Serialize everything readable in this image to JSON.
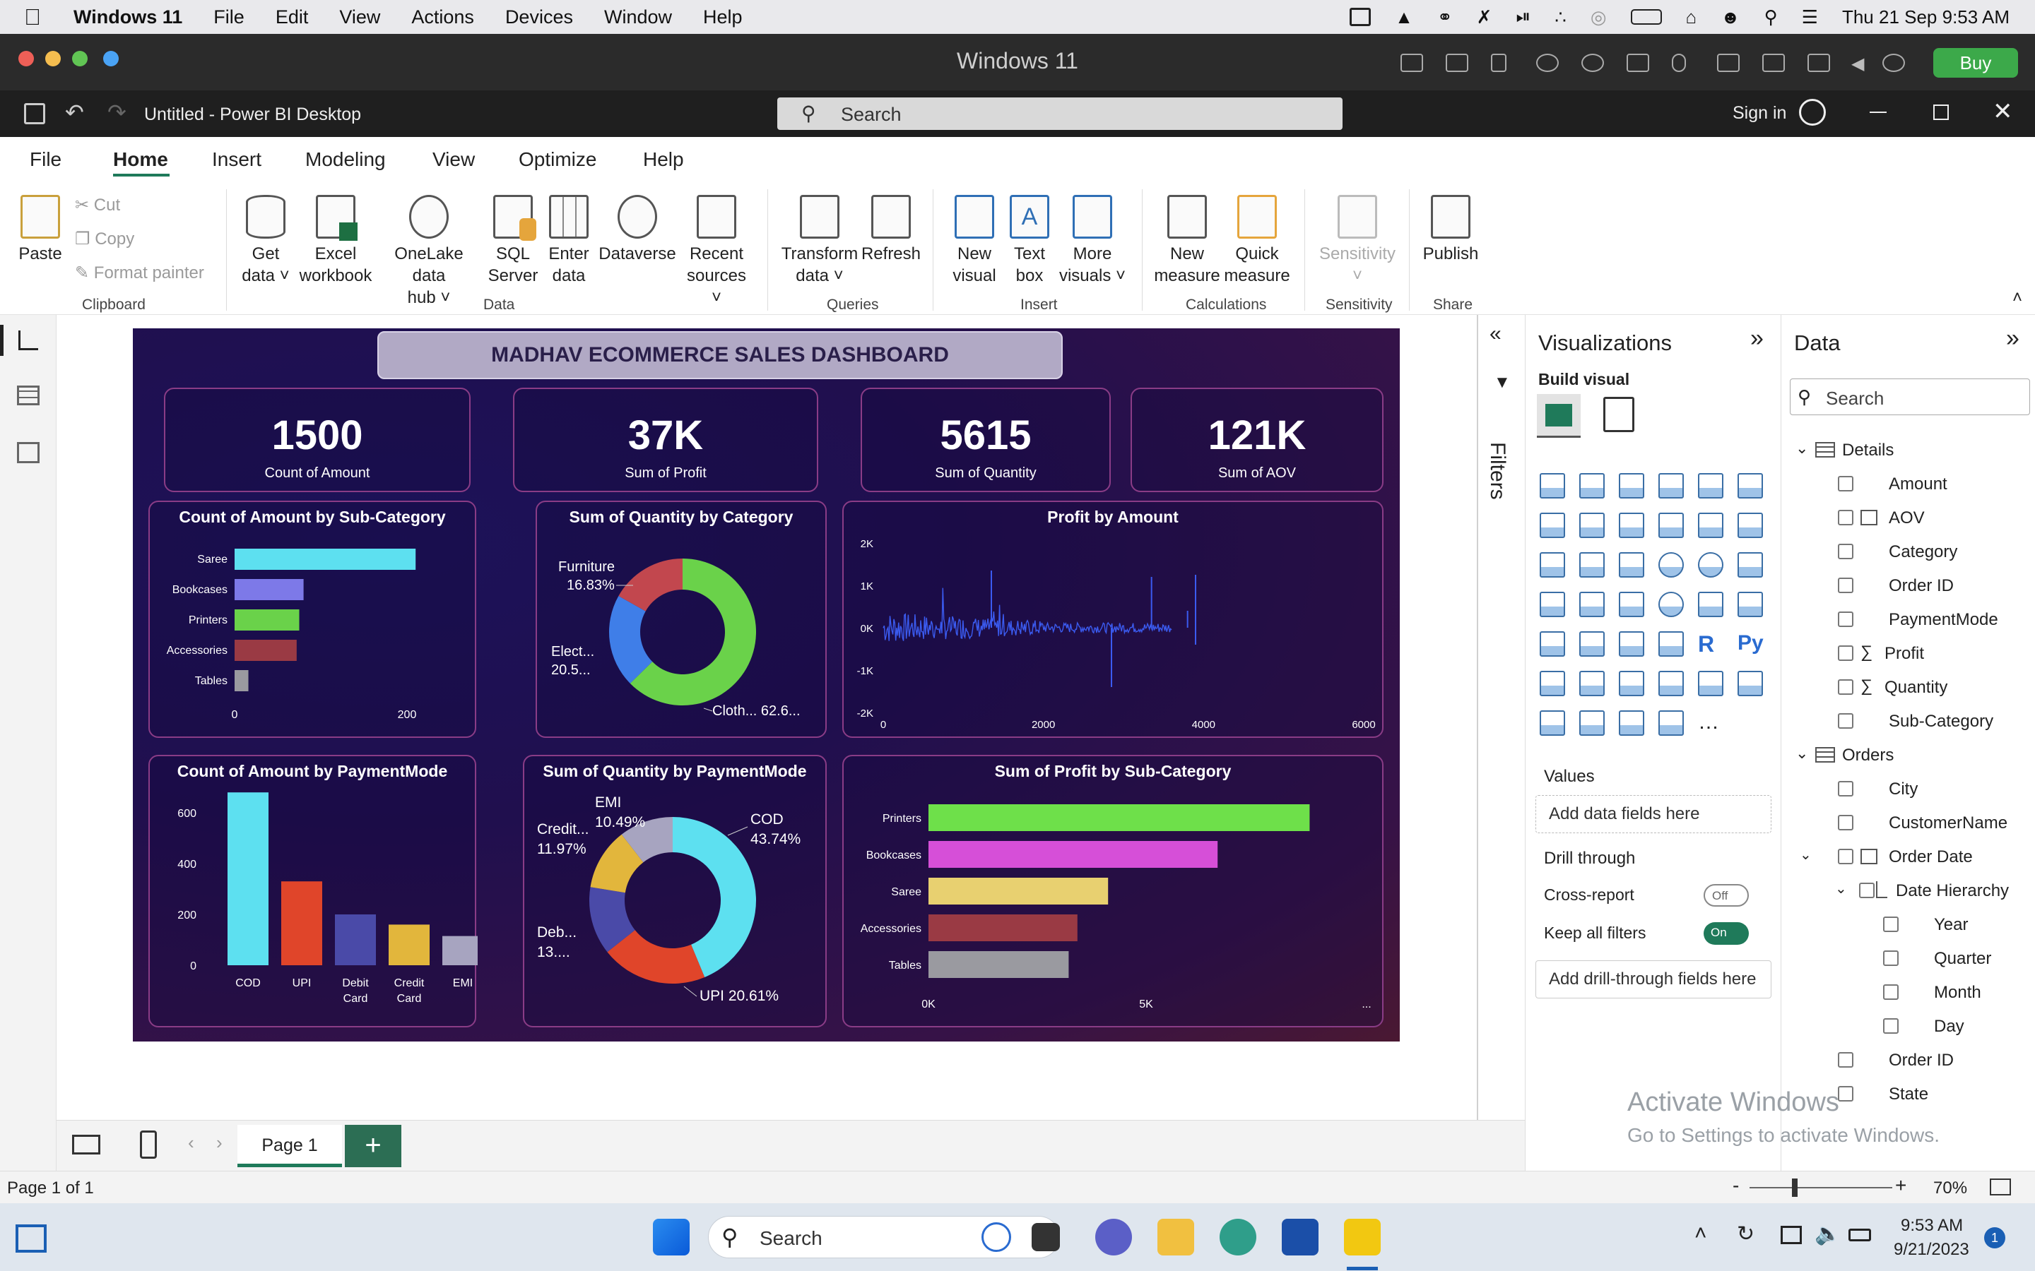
{
  "mac_menu": {
    "app": "Windows 11",
    "items": [
      "File",
      "Edit",
      "View",
      "Actions",
      "Devices",
      "Window",
      "Help"
    ],
    "clock": "Thu 21 Sep  9:53 AM"
  },
  "parallels": {
    "title": "Windows 11",
    "buy": "Buy"
  },
  "titlebar": {
    "doc_title": "Untitled - Power BI Desktop",
    "search_placeholder": "Search",
    "sign_in": "Sign in"
  },
  "tabs": [
    "File",
    "Home",
    "Insert",
    "Modeling",
    "View",
    "Optimize",
    "Help"
  ],
  "ribbon": {
    "paste": "Paste",
    "cut": "Cut",
    "copy": "Copy",
    "format_painter": "Format painter",
    "get_data_1": "Get",
    "get_data_2": "data",
    "excel_1": "Excel",
    "excel_2": "workbook",
    "onelake_1": "OneLake data",
    "onelake_2": "hub",
    "sql_1": "SQL",
    "sql_2": "Server",
    "enter_1": "Enter",
    "enter_2": "data",
    "dataverse": "Dataverse",
    "recent_1": "Recent",
    "recent_2": "sources",
    "transform_1": "Transform",
    "transform_2": "data",
    "refresh": "Refresh",
    "newvisual_1": "New",
    "newvisual_2": "visual",
    "textbox_1": "Text",
    "textbox_2": "box",
    "morevisuals_1": "More",
    "morevisuals_2": "visuals",
    "newmeasure_1": "New",
    "newmeasure_2": "measure",
    "quick_1": "Quick",
    "quick_2": "measure",
    "sensitivity": "Sensitivity",
    "publish": "Publish",
    "groups": {
      "clipboard": "Clipboard",
      "data": "Data",
      "queries": "Queries",
      "insert": "Insert",
      "calculations": "Calculations",
      "sensitivity": "Sensitivity",
      "share": "Share"
    }
  },
  "dashboard": {
    "title": "MADHAV ECOMMERCE SALES DASHBOARD",
    "kpis": [
      {
        "value": "1500",
        "label": "Count of Amount"
      },
      {
        "value": "37K",
        "label": "Sum of Profit"
      },
      {
        "value": "5615",
        "label": "Sum of Quantity"
      },
      {
        "value": "121K",
        "label": "Sum of AOV"
      }
    ],
    "visual_titles": {
      "subcat": "Count of Amount by Sub-Category",
      "category": "Sum of Quantity by Category",
      "profit_amount": "Profit by Amount",
      "paymode": "Count of Amount by PaymentMode",
      "qty_paymode": "Sum of Quantity by PaymentMode",
      "profit_subcat": "Sum of Profit by Sub-Category"
    }
  },
  "chart_data": [
    {
      "type": "bar",
      "orientation": "horizontal",
      "title": "Count of Amount by Sub-Category",
      "categories": [
        "Saree",
        "Bookcases",
        "Printers",
        "Accessories",
        "Tables"
      ],
      "values": [
        210,
        80,
        75,
        72,
        16
      ],
      "colors": [
        "#5de0f0",
        "#7d79e8",
        "#6ad24a",
        "#9a3a44",
        "#9a9aa0"
      ],
      "x_ticks": [
        "0",
        "200"
      ],
      "xlim": [
        0,
        250
      ]
    },
    {
      "type": "pie",
      "donut": true,
      "title": "Sum of Quantity by Category",
      "labels": [
        "Clothing",
        "Electronics",
        "Furniture"
      ],
      "label_text": [
        "Cloth... 62.6...",
        "Elect... 20.5...",
        "Furniture 16.83%"
      ],
      "values": [
        62.6,
        20.5,
        16.83
      ],
      "colors": [
        "#6ad24a",
        "#3f7ee8",
        "#c2474e"
      ]
    },
    {
      "type": "line",
      "title": "Profit by Amount",
      "x_ticks": [
        "0",
        "2000",
        "4000",
        "6000"
      ],
      "y_ticks": [
        "2K",
        "1K",
        "0K",
        "-1K",
        "-2K"
      ],
      "xlim": [
        0,
        6000
      ],
      "ylim": [
        -2000,
        2000
      ],
      "color": "#3b5bf0"
    },
    {
      "type": "bar",
      "orientation": "vertical",
      "title": "Count of Amount by PaymentMode",
      "categories": [
        "COD",
        "UPI",
        "Debit Card",
        "Credit Card",
        "EMI"
      ],
      "values": [
        680,
        330,
        200,
        160,
        115
      ],
      "colors": [
        "#5de0f0",
        "#e0452a",
        "#4a4aa8",
        "#e2b63c",
        "#a7a4c0"
      ],
      "y_ticks": [
        "600",
        "400",
        "200",
        "0"
      ],
      "ylim": [
        0,
        700
      ]
    },
    {
      "type": "pie",
      "donut": true,
      "title": "Sum of Quantity by PaymentMode",
      "labels": [
        "COD",
        "UPI",
        "Debit Card",
        "Credit Card",
        "EMI"
      ],
      "label_text": [
        "COD 43.74%",
        "UPI 20.61%",
        "Deb... 13....",
        "Credit... 11.97%",
        "EMI 10.49%"
      ],
      "values": [
        43.74,
        20.61,
        13.19,
        11.97,
        10.49
      ],
      "colors": [
        "#5de0f0",
        "#e0452a",
        "#4a4aa8",
        "#e2b63c",
        "#a7a4c0"
      ]
    },
    {
      "type": "bar",
      "orientation": "horizontal",
      "title": "Sum of Profit by Sub-Category",
      "categories": [
        "Printers",
        "Bookcases",
        "Saree",
        "Accessories",
        "Tables"
      ],
      "values": [
        8700,
        6600,
        4100,
        3400,
        3200
      ],
      "colors": [
        "#6ee04a",
        "#d64fd8",
        "#e8d070",
        "#9a3a44",
        "#9a9aa0"
      ],
      "x_ticks": [
        "0K",
        "5K",
        "..."
      ],
      "xlim": [
        0,
        10000
      ]
    }
  ],
  "filters_label": "Filters",
  "visualizations": {
    "title": "Visualizations",
    "build_visual": "Build visual",
    "values": "Values",
    "add_data": "Add data fields here",
    "drill_through": "Drill through",
    "cross_report": "Cross-report",
    "cross_state": "Off",
    "keep_filters": "Keep all filters",
    "keep_state": "On",
    "add_drill": "Add drill-through fields here"
  },
  "data_pane": {
    "title": "Data",
    "search_placeholder": "Search",
    "tables": [
      {
        "name": "Details",
        "fields": [
          "Amount",
          "AOV",
          "Category",
          "Order ID",
          "PaymentMode",
          "Profit",
          "Quantity",
          "Sub-Category"
        ]
      },
      {
        "name": "Orders",
        "fields": [
          "City",
          "CustomerName",
          "Order Date",
          "Date Hierarchy",
          "Year",
          "Quarter",
          "Month",
          "Day",
          "Order ID",
          "State"
        ]
      }
    ]
  },
  "page_tab": "Page 1",
  "status": {
    "page": "Page 1 of 1",
    "zoom": "70%"
  },
  "watermark": {
    "line1": "Activate Windows",
    "line2": "Go to Settings to activate Windows."
  },
  "taskbar": {
    "search": "Search",
    "time": "9:53 AM",
    "date": "9/21/2023",
    "badge": "1"
  }
}
